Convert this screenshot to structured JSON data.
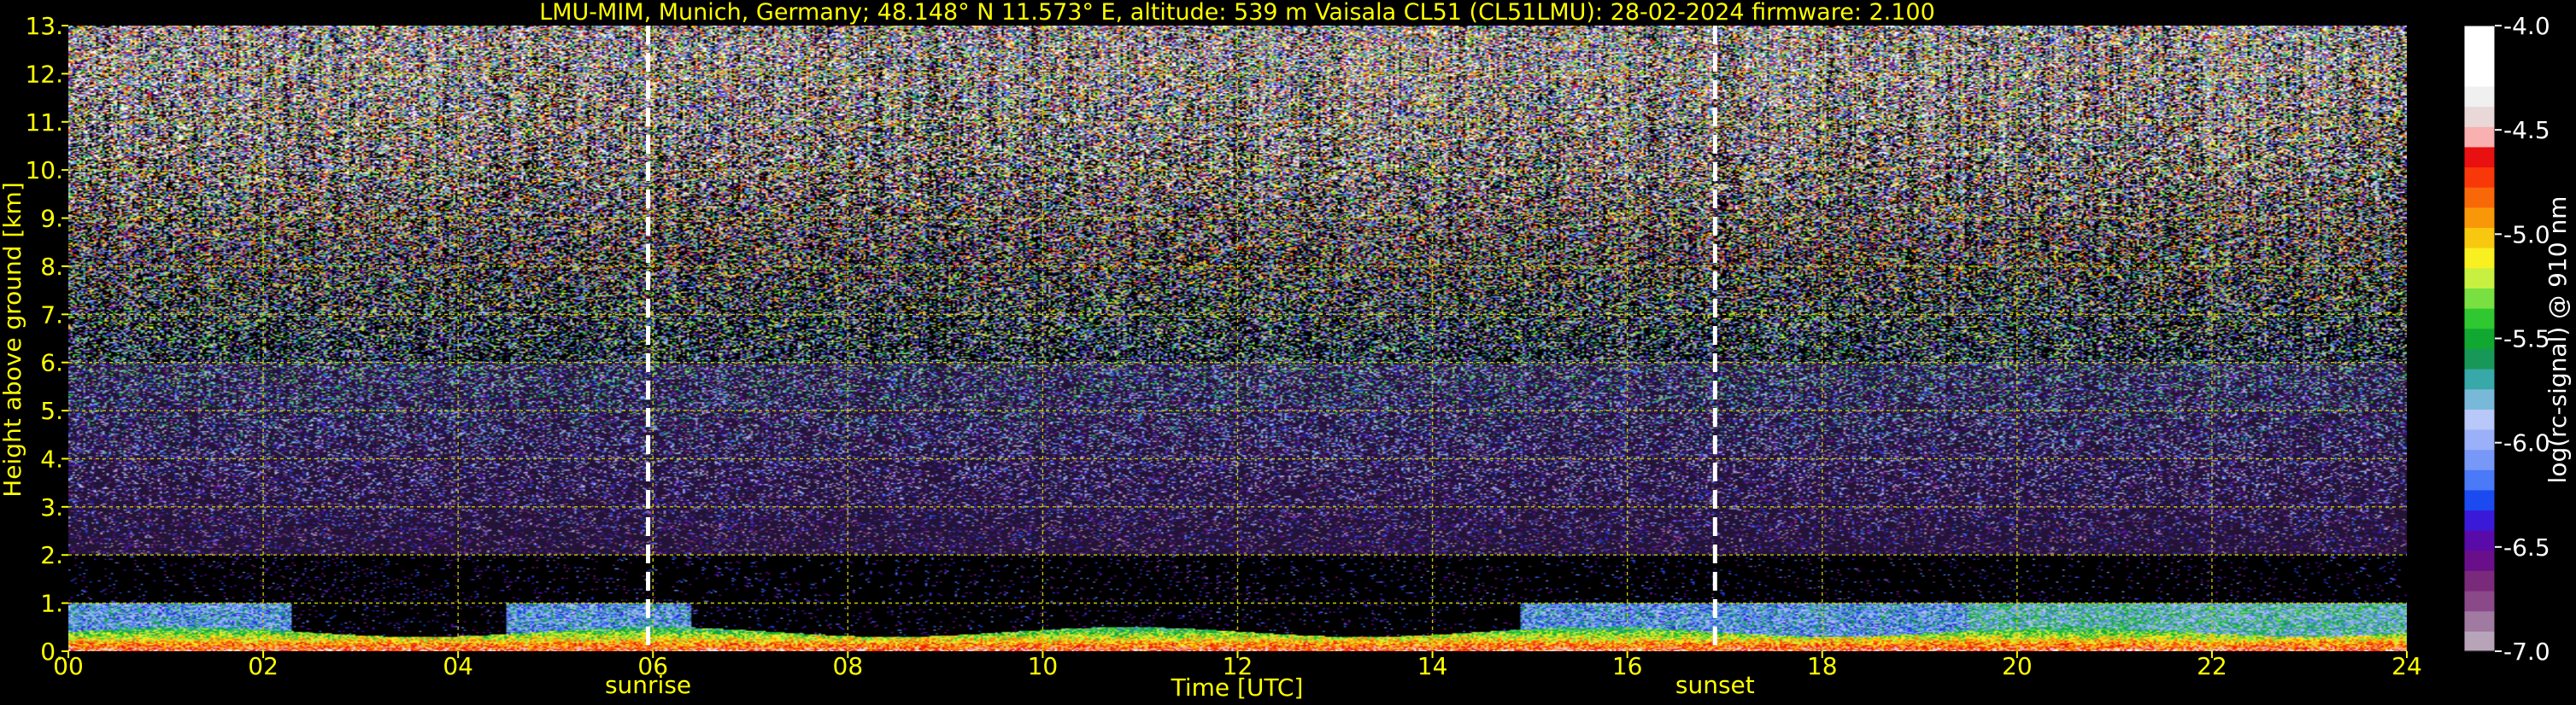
{
  "chart_data": {
    "type": "heatmap",
    "title": "LMU-MIM, Munich, Germany; 48.148° N 11.573° E, altitude: 539 m    Vaisala CL51 (CL51LMU): 28-02-2024    firmware: 2.100",
    "xlabel": "Time [UTC]",
    "ylabel": "Height above ground [km]",
    "colorbar_label": "log(rc-signal) @ 910 nm",
    "xlim": [
      0,
      24
    ],
    "ylim": [
      0,
      13
    ],
    "x_ticks": [
      0,
      2,
      4,
      6,
      8,
      10,
      12,
      14,
      16,
      18,
      20,
      22,
      24
    ],
    "x_tick_labels": [
      "00",
      "02",
      "04",
      "06",
      "08",
      "10",
      "12",
      "14",
      "16",
      "18",
      "20",
      "22",
      "24"
    ],
    "y_ticks": [
      0,
      1,
      2,
      3,
      4,
      5,
      6,
      7,
      8,
      9,
      10,
      11,
      12,
      13
    ],
    "y_tick_labels": [
      "0.",
      "1.",
      "2.",
      "3.",
      "4.",
      "5.",
      "6.",
      "7.",
      "8.",
      "9.",
      "10.",
      "11.",
      "12.",
      "13."
    ],
    "grid": true,
    "colorbar": {
      "range": [
        -7.0,
        -4.0
      ],
      "ticks": [
        -4.0,
        -4.5,
        -5.0,
        -5.5,
        -6.0,
        -6.5,
        -7.0
      ],
      "tick_labels": [
        "-4.0",
        "-4.5",
        "-5.0",
        "-5.5",
        "-6.0",
        "-6.5",
        "-7.0"
      ],
      "colors": [
        "#b8a4b8",
        "#a07aa0",
        "#8a4a8a",
        "#7a2a7a",
        "#6a0f8a",
        "#5a0aa8",
        "#3a1ad8",
        "#1a4af0",
        "#4a7af8",
        "#7898f8",
        "#9ab0f8",
        "#b8c8f8",
        "#78b8d8",
        "#38a8a8",
        "#189858",
        "#10a830",
        "#30c830",
        "#78e040",
        "#c8f040",
        "#f8f020",
        "#f8c810",
        "#f89808",
        "#f86808",
        "#f83808",
        "#e81010",
        "#f8b0b0",
        "#e8d8d8",
        "#f0f0f0",
        "#ffffff",
        "#ffffff",
        "#ffffff"
      ]
    },
    "markers": [
      {
        "label": "sunrise",
        "x": 5.95
      },
      {
        "label": "sunset",
        "x": 16.9
      }
    ],
    "features": {
      "cloud_top_height_km": 1.0,
      "boundary_layer_top_km": 0.35,
      "noise_onset_km": 2.0
    }
  }
}
